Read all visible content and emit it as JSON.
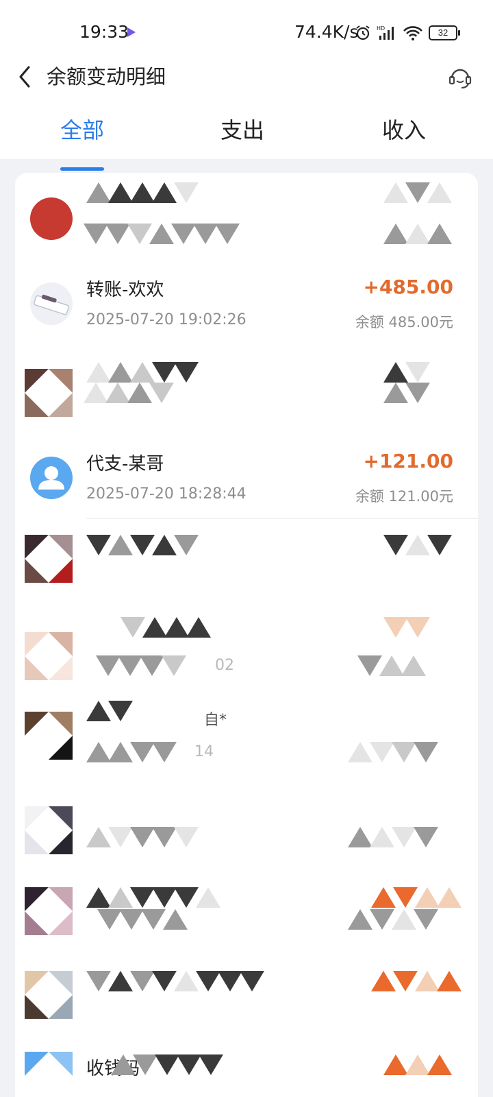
{
  "status_bar": {
    "time": "19:33",
    "net_speed": "74.4K/s",
    "battery": "32",
    "icons": [
      "play-icon",
      "alarm-icon",
      "hd-signal-icon",
      "wifi-icon",
      "battery-icon"
    ]
  },
  "header": {
    "title": "余额变动明细",
    "back_icon": "back-chevron-icon",
    "support_icon": "headset-icon"
  },
  "tabs": [
    {
      "label": "全部",
      "active": true
    },
    {
      "label": "支出",
      "active": false
    },
    {
      "label": "收入",
      "active": false
    }
  ],
  "colors": {
    "accent": "#2b7de9",
    "income": "#e26a2c",
    "muted": "#8e8e8e"
  },
  "transactions": [
    {
      "name": "转账-欢欢",
      "time": "2025-07-20 19:02:26",
      "amount": "+485.00",
      "balance": "余额 485.00元"
    },
    {
      "name": "代支-某哥",
      "time": "2025-07-20 18:28:44",
      "amount": "+121.00",
      "balance": "余额 121.00元"
    }
  ],
  "obscured": {
    "fragment_1": "02",
    "fragment_2": "自*",
    "fragment_3": "14",
    "fragment_4": "收钱码"
  }
}
